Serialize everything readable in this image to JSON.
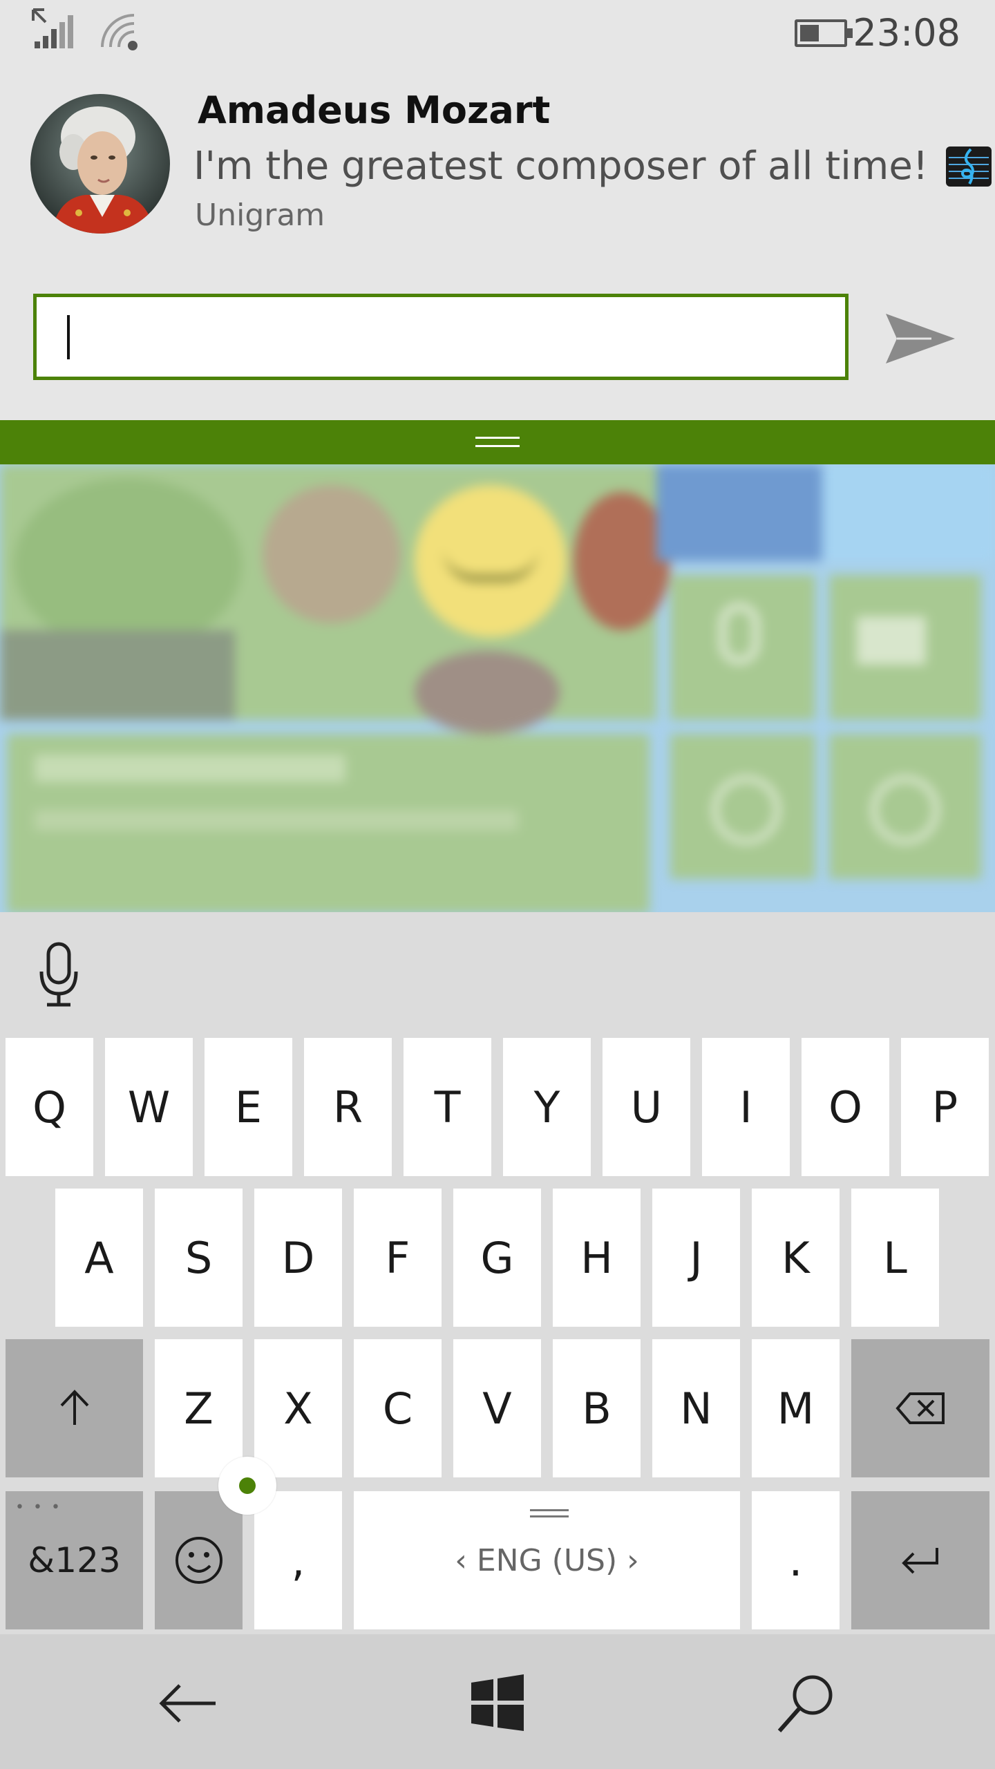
{
  "status_bar": {
    "time": "23:08",
    "battery_level": 0.45,
    "icons": [
      "data-arrow-icon",
      "signal-icon",
      "wifi-icon",
      "battery-icon"
    ]
  },
  "notification": {
    "contact_name": "Amadeus Mozart",
    "message": "I'm the greatest composer of all time!",
    "app_name": "Unigram",
    "emoji_icon": "treble-clef-music-icon",
    "reply_value": "",
    "accent_color": "#4c8208"
  },
  "keyboard": {
    "row1": [
      "Q",
      "W",
      "E",
      "R",
      "T",
      "Y",
      "U",
      "I",
      "O",
      "P"
    ],
    "row2": [
      "A",
      "S",
      "D",
      "F",
      "G",
      "H",
      "J",
      "K",
      "L"
    ],
    "row3": [
      "Z",
      "X",
      "C",
      "V",
      "B",
      "N",
      "M"
    ],
    "numbers_key": "&123",
    "comma_key": ",",
    "space_label": "‹ ENG (US) ›",
    "period_key": "."
  },
  "nav_bar": {
    "buttons": [
      "back-icon",
      "windows-start-icon",
      "search-icon"
    ]
  }
}
